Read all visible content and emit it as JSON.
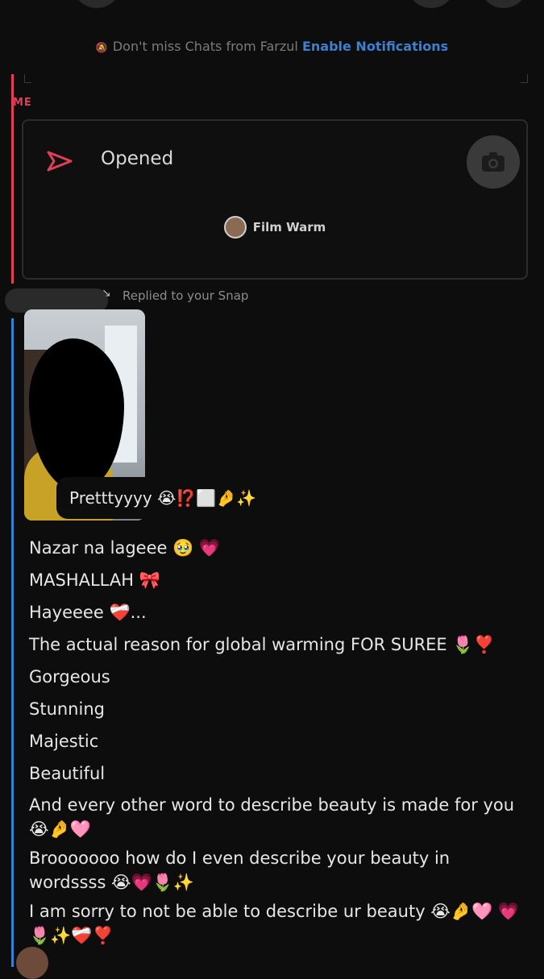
{
  "notification": {
    "text": "Don't miss Chats from Farzul",
    "cta": "Enable Notifications"
  },
  "me": {
    "label": "ME",
    "snap_status": "Opened",
    "lens_name": "Film Warm",
    "accent_color": "#e23e57"
  },
  "them": {
    "reply_text": "Replied to your Snap",
    "caption": "Pretttyyyy 😭⁉️⬜🤌✨",
    "accent_color": "#2f82d6",
    "messages": [
      "Nazar na lageee 🥹 💗",
      "MASHALLAH 🎀",
      "Hayeeee ❤️‍🩹...",
      "The actual reason for global warming FOR SUREE 🌷❣️",
      "Gorgeous",
      "Stunning",
      "Majestic",
      "Beautiful",
      "And every other word to describe beauty is made for you 😭🤌🩷",
      "Brooooooo how do I even describe your beauty in wordssss 😭💗🌷✨",
      "I am sorry to not be able to describe ur beauty 😭🤌🩷 💗🌷✨❤️‍🩹❣️"
    ]
  },
  "icons": {
    "snap_opened": "open-snap-arrow-icon",
    "camera": "camera-icon",
    "bell": "bell-icon",
    "reply": "reply-arrow-icon"
  }
}
